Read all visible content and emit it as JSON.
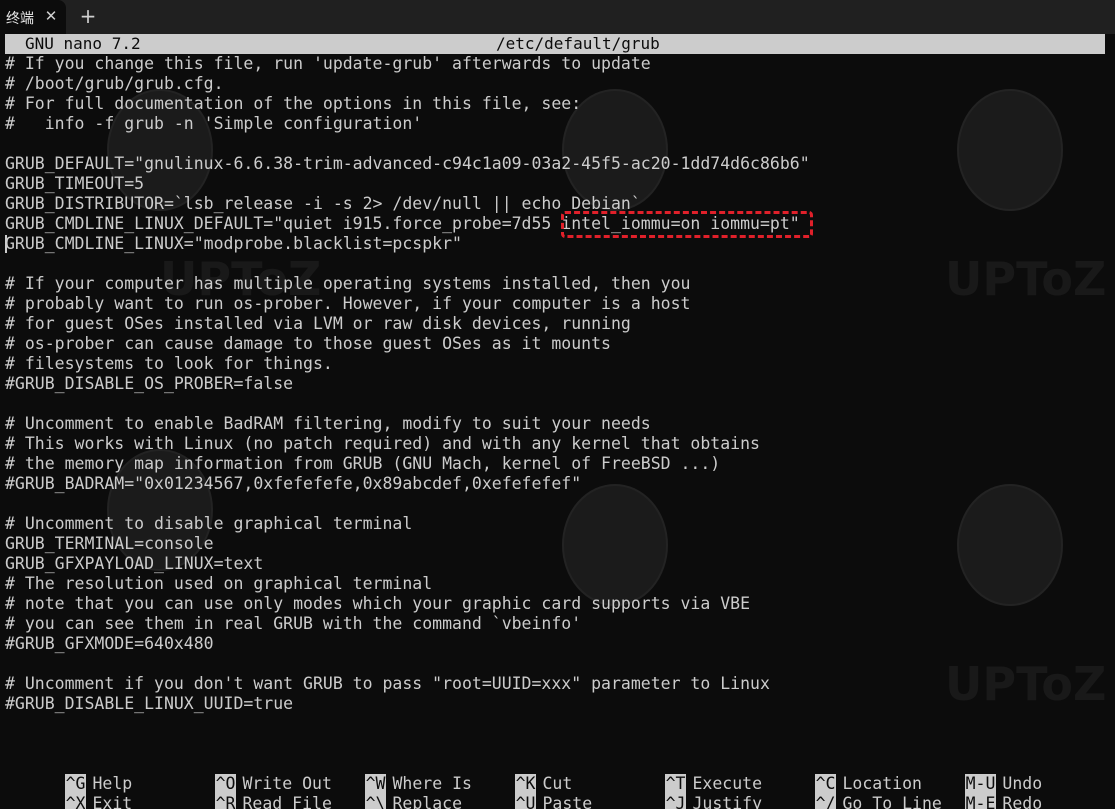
{
  "tabbar": {
    "tab_label": "终端",
    "close_glyph": "✕",
    "new_tab_glyph": "+"
  },
  "nano": {
    "version": "GNU nano 7.2",
    "filename": "/etc/default/grub"
  },
  "lines": [
    "# If you change this file, run 'update-grub' afterwards to update",
    "# /boot/grub/grub.cfg.",
    "# For full documentation of the options in this file, see:",
    "#   info -f grub -n 'Simple configuration'",
    "",
    "GRUB_DEFAULT=\"gnulinux-6.6.38-trim-advanced-c94c1a09-03a2-45f5-ac20-1dd74d6c86b6\"",
    "GRUB_TIMEOUT=5",
    "GRUB_DISTRIBUTOR=`lsb_release -i -s 2> /dev/null || echo Debian`",
    "GRUB_CMDLINE_LINUX_DEFAULT=\"quiet i915.force_probe=7d55 intel_iommu=on iommu=pt\"",
    "GRUB_CMDLINE_LINUX=\"modprobe.blacklist=pcspkr\"",
    "",
    "# If your computer has multiple operating systems installed, then you",
    "# probably want to run os-prober. However, if your computer is a host",
    "# for guest OSes installed via LVM or raw disk devices, running",
    "# os-prober can cause damage to those guest OSes as it mounts",
    "# filesystems to look for things.",
    "#GRUB_DISABLE_OS_PROBER=false",
    "",
    "# Uncomment to enable BadRAM filtering, modify to suit your needs",
    "# This works with Linux (no patch required) and with any kernel that obtains",
    "# the memory map information from GRUB (GNU Mach, kernel of FreeBSD ...)",
    "#GRUB_BADRAM=\"0x01234567,0xfefefefe,0x89abcdef,0xefefefef\"",
    "",
    "# Uncomment to disable graphical terminal",
    "GRUB_TERMINAL=console",
    "GRUB_GFXPAYLOAD_LINUX=text",
    "# The resolution used on graphical terminal",
    "# note that you can use only modes which your graphic card supports via VBE",
    "# you can see them in real GRUB with the command `vbeinfo'",
    "#GRUB_GFXMODE=640x480",
    "",
    "# Uncomment if you don't want GRUB to pass \"root=UUID=xxx\" parameter to Linux",
    "#GRUB_DISABLE_LINUX_UUID=true"
  ],
  "shortcuts": {
    "help": {
      "key": "^G",
      "label": "Help"
    },
    "write_out": {
      "key": "^O",
      "label": "Write Out"
    },
    "where_is": {
      "key": "^W",
      "label": "Where Is"
    },
    "cut": {
      "key": "^K",
      "label": "Cut"
    },
    "execute": {
      "key": "^T",
      "label": "Execute"
    },
    "location": {
      "key": "^C",
      "label": "Location"
    },
    "undo": {
      "key": "M-U",
      "label": "Undo"
    },
    "exit": {
      "key": "^X",
      "label": "Exit"
    },
    "read_file": {
      "key": "^R",
      "label": "Read File"
    },
    "replace": {
      "key": "^\\",
      "label": "Replace"
    },
    "paste": {
      "key": "^U",
      "label": "Paste"
    },
    "justify": {
      "key": "^J",
      "label": "Justify"
    },
    "go_to_line": {
      "key": "^/",
      "label": "Go To Line"
    },
    "redo": {
      "key": "M-E",
      "label": "Redo"
    }
  },
  "watermark_text": "UPToZ"
}
